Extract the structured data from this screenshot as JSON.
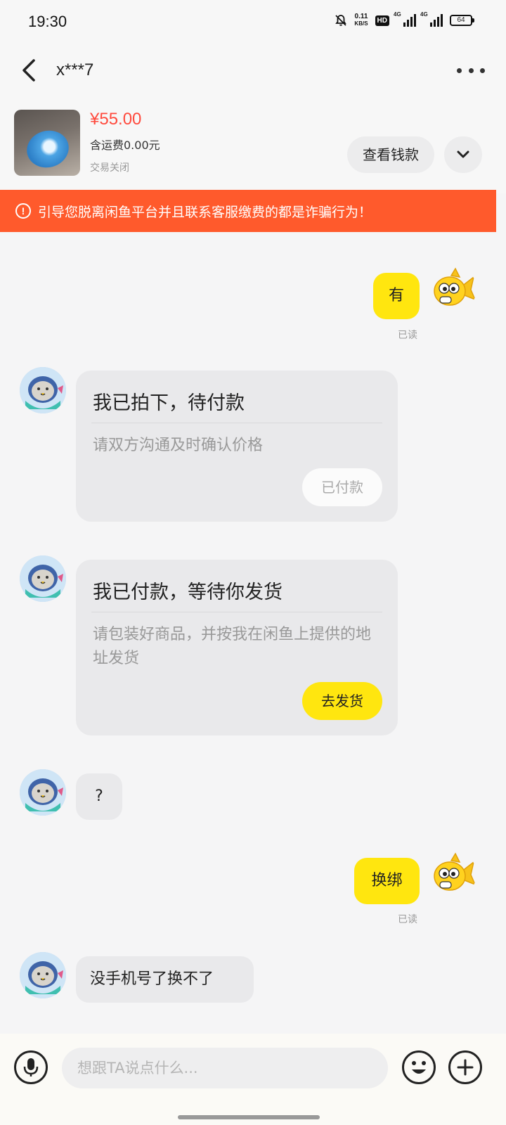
{
  "status_bar": {
    "time": "19:30",
    "net_speed_value": "0.11",
    "net_speed_unit": "KB/S",
    "hd_label": "HD",
    "signal1_label": "4G",
    "signal2_label": "4G",
    "battery": "64"
  },
  "header": {
    "title": "x***7"
  },
  "product": {
    "price": "¥55.00",
    "shipping": "含运费0.00元",
    "status": "交易关闭",
    "view_money_label": "查看钱款"
  },
  "warning": {
    "text": "引导您脱离闲鱼平台并且联系客服缴费的都是诈骗行为！"
  },
  "messages": {
    "m1": {
      "text": "有",
      "read": "已读"
    },
    "card1": {
      "title": "我已拍下，待付款",
      "desc": "请双方沟通及时确认价格",
      "button": "已付款"
    },
    "card2": {
      "title": "我已付款，等待你发货",
      "desc": "请包装好商品，并按我在闲鱼上提供的地址发货",
      "button": "去发货"
    },
    "m2": {
      "text": "?"
    },
    "m3": {
      "text": "换绑",
      "read": "已读"
    },
    "m4": {
      "text": "没手机号了换不了"
    }
  },
  "input": {
    "placeholder": "想跟TA说点什么..."
  },
  "colors": {
    "accent_yellow": "#ffe60f",
    "warning_orange": "#ff5a2c",
    "price_red": "#ff4a3d"
  }
}
